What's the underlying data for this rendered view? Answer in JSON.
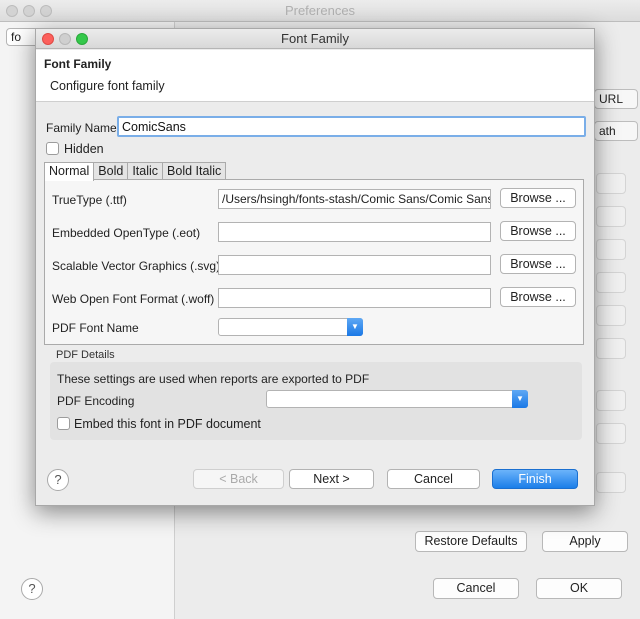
{
  "bg_window": {
    "title": "Preferences",
    "filter_text": "fo",
    "frag_url": "URL",
    "frag_path": "ath",
    "restore_defaults": "Restore Defaults",
    "apply": "Apply",
    "cancel": "Cancel",
    "ok": "OK",
    "help": "?"
  },
  "dialog": {
    "title": "Font Family",
    "banner": {
      "title": "Font Family",
      "description": "Configure font family"
    },
    "family_name": {
      "label": "Family Name",
      "value": "ComicSans"
    },
    "hidden_label": "Hidden",
    "tabs": [
      "Normal",
      "Bold",
      "Italic",
      "Bold Italic"
    ],
    "fields": [
      {
        "label": "TrueType (.ttf)",
        "value": "/Users/hsingh/fonts-stash/Comic Sans/Comic Sans",
        "browse": "Browse ..."
      },
      {
        "label": "Embedded OpenType (.eot)",
        "value": "",
        "browse": "Browse ..."
      },
      {
        "label": "Scalable Vector Graphics (.svg)",
        "value": "",
        "browse": "Browse ..."
      },
      {
        "label": "Web Open Font Format (.woff)",
        "value": "",
        "browse": "Browse ..."
      }
    ],
    "pdf_font_name_label": "PDF Font Name",
    "pdf_details": {
      "group_label": "PDF Details",
      "description": "These settings are used when reports are exported to PDF",
      "encoding_label": "PDF Encoding",
      "embed_label": "Embed this font in PDF document"
    },
    "buttons": {
      "help": "?",
      "back": "< Back",
      "next": "Next >",
      "cancel": "Cancel",
      "finish": "Finish"
    }
  }
}
